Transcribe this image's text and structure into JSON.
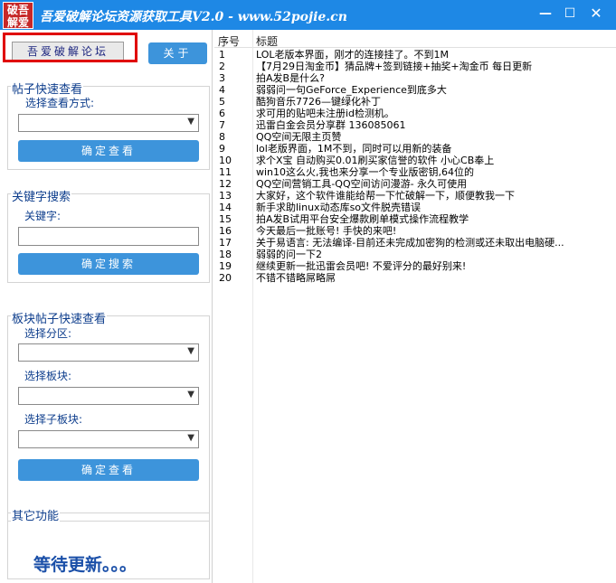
{
  "window": {
    "logo_line1": "破吾",
    "logo_line2": "解爱",
    "title": "吾爱破解论坛资源获取工具V2.0 - www.52pojie.cn",
    "min_symbol": "—",
    "max_symbol": "☐",
    "close_symbol": "✕"
  },
  "toolbar": {
    "forum_button": "吾爱破解论坛",
    "about_button": "关于"
  },
  "quick_view": {
    "group_title": "帖子快速查看",
    "mode_label": "选择查看方式:",
    "mode_value": "",
    "confirm_button": "确定查看"
  },
  "keyword_search": {
    "group_title": "关键字搜索",
    "keyword_label": "关键字:",
    "keyword_value": "",
    "search_button": "确定搜索"
  },
  "board_view": {
    "group_title": "板块帖子快速查看",
    "section_label": "选择分区:",
    "board_label": "选择板块:",
    "subboard_label": "选择子板块:",
    "confirm_button": "确定查看"
  },
  "other": {
    "group_title": "其它功能",
    "pending_text": "等待更新。。。"
  },
  "list": {
    "columns": {
      "num": "序号",
      "title": "标题"
    },
    "rows": [
      {
        "num": "1",
        "title": "LOL老版本界面，刚才的连接挂了。不到1M"
      },
      {
        "num": "2",
        "title": "【7月29日淘金币】猜品牌+签到链接+抽奖+淘金币 每日更新"
      },
      {
        "num": "3",
        "title": "拍A发B是什么?"
      },
      {
        "num": "4",
        "title": "弱弱问一句GeForce_Experience到底多大"
      },
      {
        "num": "5",
        "title": "酷狗音乐7726—键绿化补丁"
      },
      {
        "num": "6",
        "title": "求可用的贴吧未注册id检测机。"
      },
      {
        "num": "7",
        "title": "迅雷白金会员分享群 136085061"
      },
      {
        "num": "8",
        "title": "QQ空间无限主页赞"
      },
      {
        "num": "9",
        "title": "lol老版界面，1M不到，同时可以用新的装备"
      },
      {
        "num": "10",
        "title": "求个X宝 自动购买0.01刷买家信誉的软件  小心CB奉上"
      },
      {
        "num": "11",
        "title": "win10这么火,我也来分享一个专业版密钥,64位的"
      },
      {
        "num": "12",
        "title": "QQ空间营销工具-QQ空间访问漫游- 永久可使用"
      },
      {
        "num": "13",
        "title": "大家好，这个软件谁能给帮一下忙破解一下，顺便教我一下"
      },
      {
        "num": "14",
        "title": "新手求助linux动态库so文件脱壳错误"
      },
      {
        "num": "15",
        "title": "拍A发B试用平台安全爆款刷单模式操作流程教学"
      },
      {
        "num": "16",
        "title": "今天最后一批账号! 手快的来吧!"
      },
      {
        "num": "17",
        "title": "关于易语言: 无法编译-目前还未完成加密狗的检测或还未取出电脑硬..."
      },
      {
        "num": "18",
        "title": "弱弱的问一下2"
      },
      {
        "num": "19",
        "title": "继续更新一批迅雷会员吧! 不爱评分的最好别来!"
      },
      {
        "num": "20",
        "title": "不错不错略屌略屌"
      }
    ]
  },
  "colors": {
    "title_bar": "#1e88e5",
    "button_blue": "#3d94db",
    "highlight_red": "#e00000",
    "label_blue": "#0d3d8c"
  }
}
